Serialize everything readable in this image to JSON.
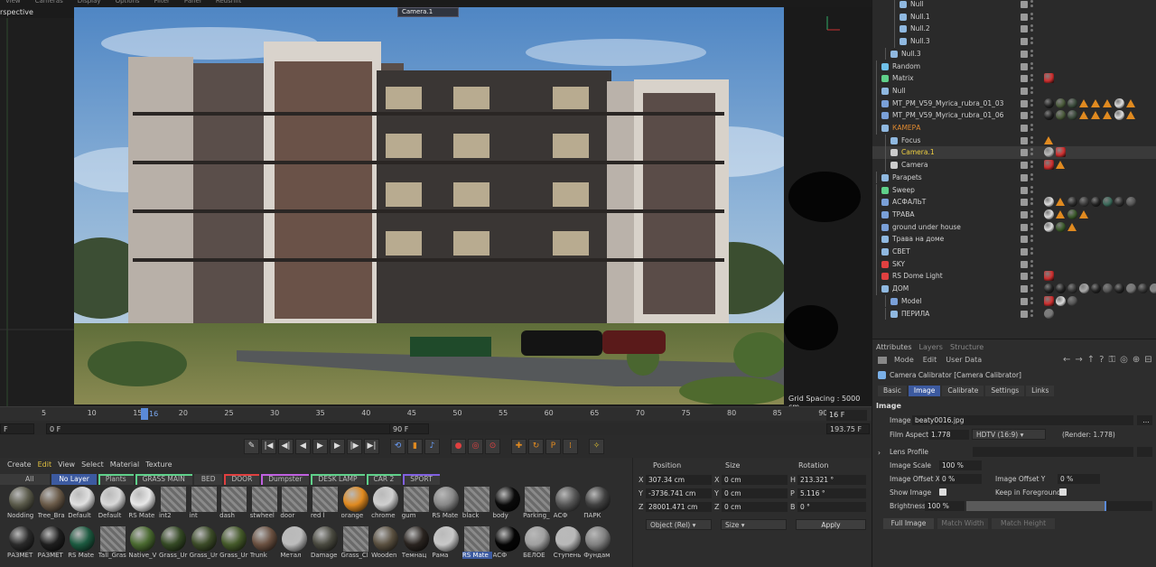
{
  "viewport": {
    "menu": [
      "View",
      "Cameras",
      "Display",
      "Options",
      "Filter",
      "Panel",
      "Redshift"
    ],
    "view_name": "rspective",
    "camera_label": "Camera.1",
    "grid_spacing": "Grid Spacing : 5000 cm"
  },
  "timeline": {
    "ticks": [
      "5",
      "10",
      "15",
      "20",
      "25",
      "30",
      "35",
      "40",
      "45",
      "50",
      "55",
      "60",
      "65",
      "70",
      "75",
      "80",
      "85",
      "90"
    ],
    "current": "16",
    "current_frame": "16 F",
    "start_field": "0 F",
    "range_start": "0 F",
    "range_end": "90 F",
    "end_field": "193.75 F",
    "left_field": "F"
  },
  "materials": {
    "menu": [
      "Create",
      "Edit",
      "View",
      "Select",
      "Material",
      "Texture"
    ],
    "tabs": [
      "All",
      "No Layer",
      "Plants",
      "GRASS MAIN",
      "BED",
      "DOOR",
      "Dumpster",
      "DESK LAMP",
      "CAR 2",
      "SPORT"
    ],
    "row1": [
      "Nodding",
      "Tree_Bra",
      "Default",
      "Default",
      "RS Mate",
      "int2",
      "int",
      "dash",
      "stwheel",
      "door",
      "red l",
      "orange",
      "chrome",
      "gum",
      "RS Mate",
      "black",
      "body",
      "Parking_",
      "АСФ",
      "ПАРК"
    ],
    "row2": [
      "РАЗМЕТ",
      "РАЗМЕТ",
      "RS Mate",
      "Tall_Gras",
      "Native_V",
      "Grass_Ur",
      "Grass_Ur",
      "Grass_Ur",
      "Trunk",
      "Метал",
      "Damage",
      "Grass_Cl",
      "Wooden",
      "Темнац",
      "Рама",
      "RS Mate",
      "АСФ",
      "БЕЛОЕ",
      "Ступень",
      "Фундам"
    ]
  },
  "coordinates": {
    "headers": [
      "Position",
      "Size",
      "Rotation"
    ],
    "rows": [
      {
        "axis": "X",
        "pos": "307.34 cm",
        "saxis": "X",
        "size": "0 cm",
        "raxis": "H",
        "rot": "213.321 °"
      },
      {
        "axis": "Y",
        "pos": "-3736.741 cm",
        "saxis": "Y",
        "size": "0 cm",
        "raxis": "P",
        "rot": "5.116 °"
      },
      {
        "axis": "Z",
        "pos": "28001.471 cm",
        "saxis": "Z",
        "size": "0 cm",
        "raxis": "B",
        "rot": "0 °"
      }
    ],
    "mode": "Object (Rel)",
    "size_mode": "Size",
    "apply": "Apply"
  },
  "objects": [
    {
      "name": "Null",
      "indent": 2,
      "color": "#8fb8e0"
    },
    {
      "name": "Null.1",
      "indent": 2,
      "color": "#8fb8e0"
    },
    {
      "name": "Null.2",
      "indent": 2,
      "color": "#8fb8e0"
    },
    {
      "name": "Null.3",
      "indent": 2,
      "color": "#8fb8e0"
    },
    {
      "name": "Null.3",
      "indent": 1,
      "color": "#8fb8e0"
    },
    {
      "name": "Random",
      "indent": 0,
      "color": "#6fc0e8"
    },
    {
      "name": "Matrix",
      "indent": 0,
      "color": "#5fd08a"
    },
    {
      "name": "Null",
      "indent": 0,
      "color": "#8fb8e0"
    },
    {
      "name": "MT_PM_V59_Myrica_rubra_01_03",
      "indent": 0,
      "color": "#7aa0d8"
    },
    {
      "name": "MT_PM_V59_Myrica_rubra_01_06",
      "indent": 0,
      "color": "#7aa0d8"
    },
    {
      "name": "КАМЕРА",
      "indent": 0,
      "color": "#8fb8e0",
      "highlight": "orange"
    },
    {
      "name": "Focus",
      "indent": 1,
      "color": "#8fb8e0"
    },
    {
      "name": "Camera.1",
      "indent": 1,
      "color": "#cccccc",
      "highlight": "yellow"
    },
    {
      "name": "Camera",
      "indent": 1,
      "color": "#cccccc"
    },
    {
      "name": "Parapets",
      "indent": 0,
      "color": "#8fb8e0"
    },
    {
      "name": "Sweep",
      "indent": 0,
      "color": "#5fd08a"
    },
    {
      "name": "АСФАЛЬТ",
      "indent": 0,
      "color": "#7aa0d8"
    },
    {
      "name": "ТРАВА",
      "indent": 0,
      "color": "#7aa0d8"
    },
    {
      "name": "ground under house",
      "indent": 0,
      "color": "#7aa0d8"
    },
    {
      "name": "Трава на доме",
      "indent": 0,
      "color": "#8fb8e0"
    },
    {
      "name": "СВЕТ",
      "indent": 0,
      "color": "#8fb8e0"
    },
    {
      "name": "SKY",
      "indent": 0,
      "color": "#e04040"
    },
    {
      "name": "RS Dome Light",
      "indent": 0,
      "color": "#e04040"
    },
    {
      "name": "ДОМ",
      "indent": 0,
      "color": "#8fb8e0"
    },
    {
      "name": "Model",
      "indent": 1,
      "color": "#7aa0d8"
    },
    {
      "name": "ПЕРИЛА",
      "indent": 1,
      "color": "#8fb8e0"
    }
  ],
  "attributes": {
    "tabs": [
      "Attributes",
      "Layers",
      "Structure"
    ],
    "menu": [
      "Mode",
      "Edit",
      "User Data"
    ],
    "object_title": "Camera Calibrator [Camera Calibrator]",
    "subtabs": [
      "Basic",
      "Image",
      "Calibrate",
      "Settings",
      "Links"
    ],
    "section": "Image",
    "image_label": "Image",
    "image_value": "beaty0016.jpg",
    "film_aspect_label": "Film Aspect",
    "film_aspect_value": "1.778",
    "film_aspect_preset": "HDTV (16:9)",
    "render_note": "(Render: 1.778)",
    "lens_profile_label": "Lens Profile",
    "image_scale_label": "Image Scale",
    "image_scale_value": "100 %",
    "offset_x_label": "Image Offset X",
    "offset_x_value": "0 %",
    "offset_y_label": "Image Offset Y",
    "offset_y_value": "0 %",
    "show_image_label": "Show Image",
    "keep_fg_label": "Keep in Foreground",
    "brightness_label": "Brightness",
    "brightness_value": "100 %",
    "brightness_level": 0.75,
    "buttons": [
      "Full Image",
      "Match Width",
      "Match Height"
    ]
  }
}
